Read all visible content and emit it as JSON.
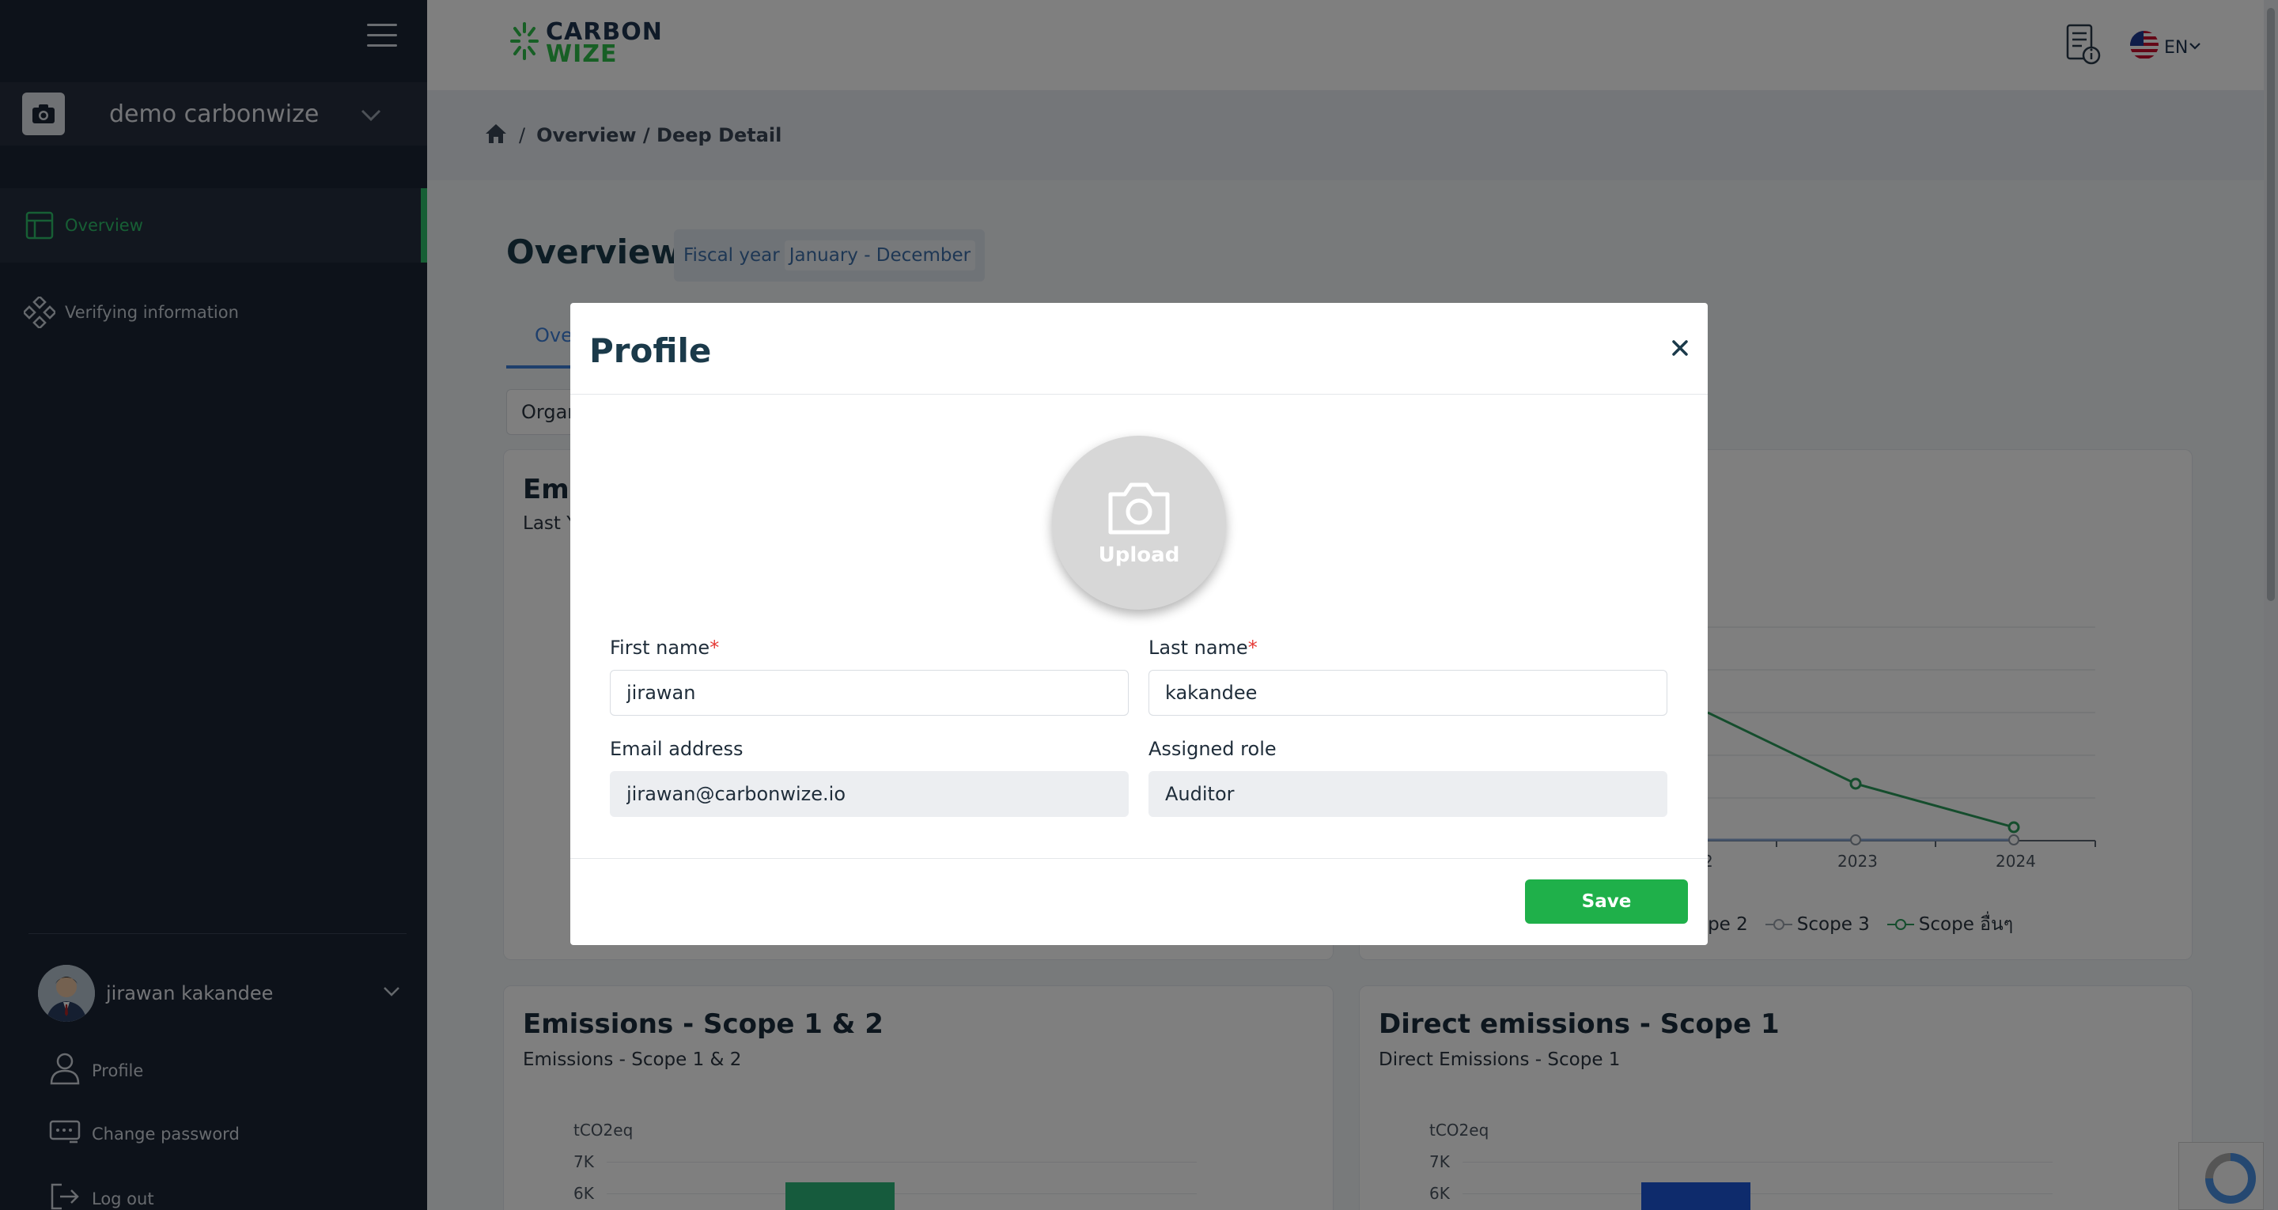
{
  "sidebar": {
    "org_name": "demo carbonwize",
    "nav": [
      {
        "label": "Overview",
        "icon": "layout-icon"
      },
      {
        "label": "Verifying information",
        "icon": "nodes-icon"
      }
    ],
    "user": {
      "name": "jirawan kakandee",
      "menu": [
        {
          "label": "Profile",
          "icon": "user-icon"
        },
        {
          "label": "Change password",
          "icon": "password-icon"
        },
        {
          "label": "Log out",
          "icon": "logout-icon"
        }
      ]
    }
  },
  "header": {
    "logo_line1": "CARBON",
    "logo_line2": "WIZE",
    "language": "EN"
  },
  "breadcrumb": {
    "separator": "/",
    "path": "Overview / Deep Detail"
  },
  "page": {
    "title": "Overview",
    "fiscal_label": "Fiscal year",
    "fiscal_value": "January - December",
    "tab_visible": "Ove",
    "org_tab_visible": "Organ"
  },
  "cards": [
    {
      "title_visible": "Emi",
      "subtitle_visible": "Last Y"
    },
    {
      "x_ticks_visible": [
        "2",
        "2023",
        "2024"
      ],
      "legend_visible": [
        "ope 2",
        "Scope 3",
        "Scope อื่นๆ"
      ]
    },
    {
      "title": "Emissions - Scope 1 & 2",
      "subtitle": "Emissions - Scope 1 & 2",
      "unit": "tCO2eq",
      "y_ticks": [
        "7K",
        "6K"
      ]
    },
    {
      "title": "Direct emissions - Scope 1",
      "subtitle": "Direct Emissions - Scope 1",
      "unit": "tCO2eq",
      "y_ticks": [
        "7K",
        "6K"
      ]
    }
  ],
  "modal": {
    "title": "Profile",
    "upload_label": "Upload",
    "first_name": {
      "label": "First name",
      "required_mark": "*",
      "value": "jirawan"
    },
    "last_name": {
      "label": "Last name",
      "required_mark": "*",
      "value": "kakandee"
    },
    "email": {
      "label": "Email address",
      "value": "jirawan@carbonwize.io"
    },
    "role": {
      "label": "Assigned role",
      "value": "Auditor"
    },
    "save_label": "Save"
  },
  "colors": {
    "sidebar_bg": "#1b2434",
    "accent_green": "#1fb04a",
    "accent_blue": "#3d7fd9",
    "required_red": "#e53935"
  }
}
